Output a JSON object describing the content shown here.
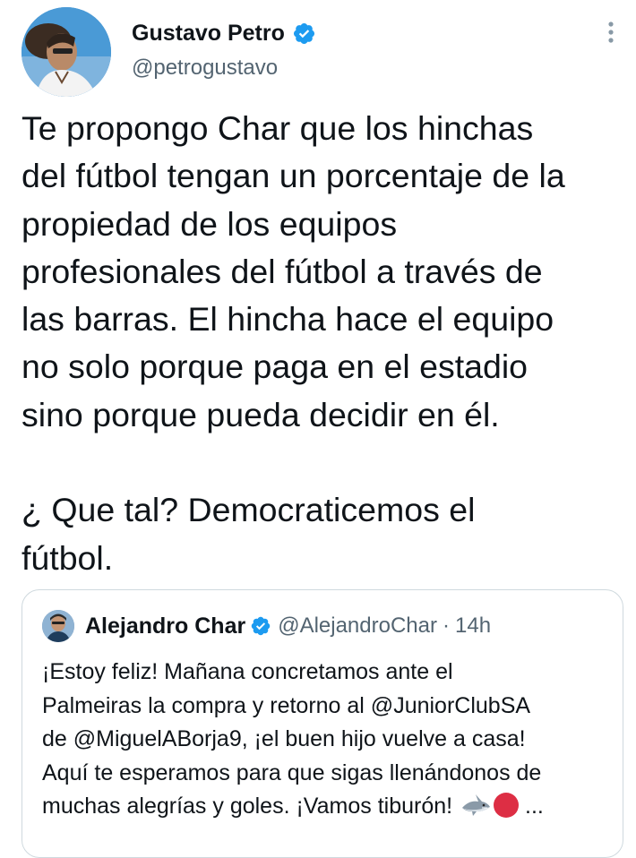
{
  "author": {
    "name": "Gustavo Petro",
    "handle": "@petrogustavo",
    "verified": true,
    "avatar_icon": "profile-photo"
  },
  "menu_icon": "more-vertical-icon",
  "tweet": {
    "lines": [
      "Te propongo Char que los hinchas",
      "del fútbol tengan un porcentaje de la",
      "propiedad de los equipos",
      "profesionales del fútbol a través de",
      "las barras. El hincha hace el equipo",
      "no solo porque paga en el estadio",
      "sino porque pueda decidir en él.",
      "",
      "¿ Que tal? Democraticemos el",
      "fútbol."
    ]
  },
  "quoted_tweet": {
    "name": "Alejandro Char",
    "handle": "@AlejandroChar",
    "separator": "·",
    "time": "14h",
    "verified": true,
    "lines": [
      "¡Estoy feliz! Mañana concretamos ante el",
      "Palmeiras la compra y retorno al @JuniorClubSA",
      "de @MiguelABorja9, ¡el buen hijo vuelve a casa!",
      "Aquí te esperamos para que sigas llenándonos de",
      "muchas alegrías y goles. ¡Vamos tiburón!"
    ],
    "trailing_emoji": [
      "shark-emoji",
      "red-circle-emoji"
    ],
    "ellipsis": "..."
  },
  "colors": {
    "text": "#0f1419",
    "secondary_text": "#536471",
    "verified_badge": "#1d9bf0",
    "border": "#cfd9de"
  }
}
